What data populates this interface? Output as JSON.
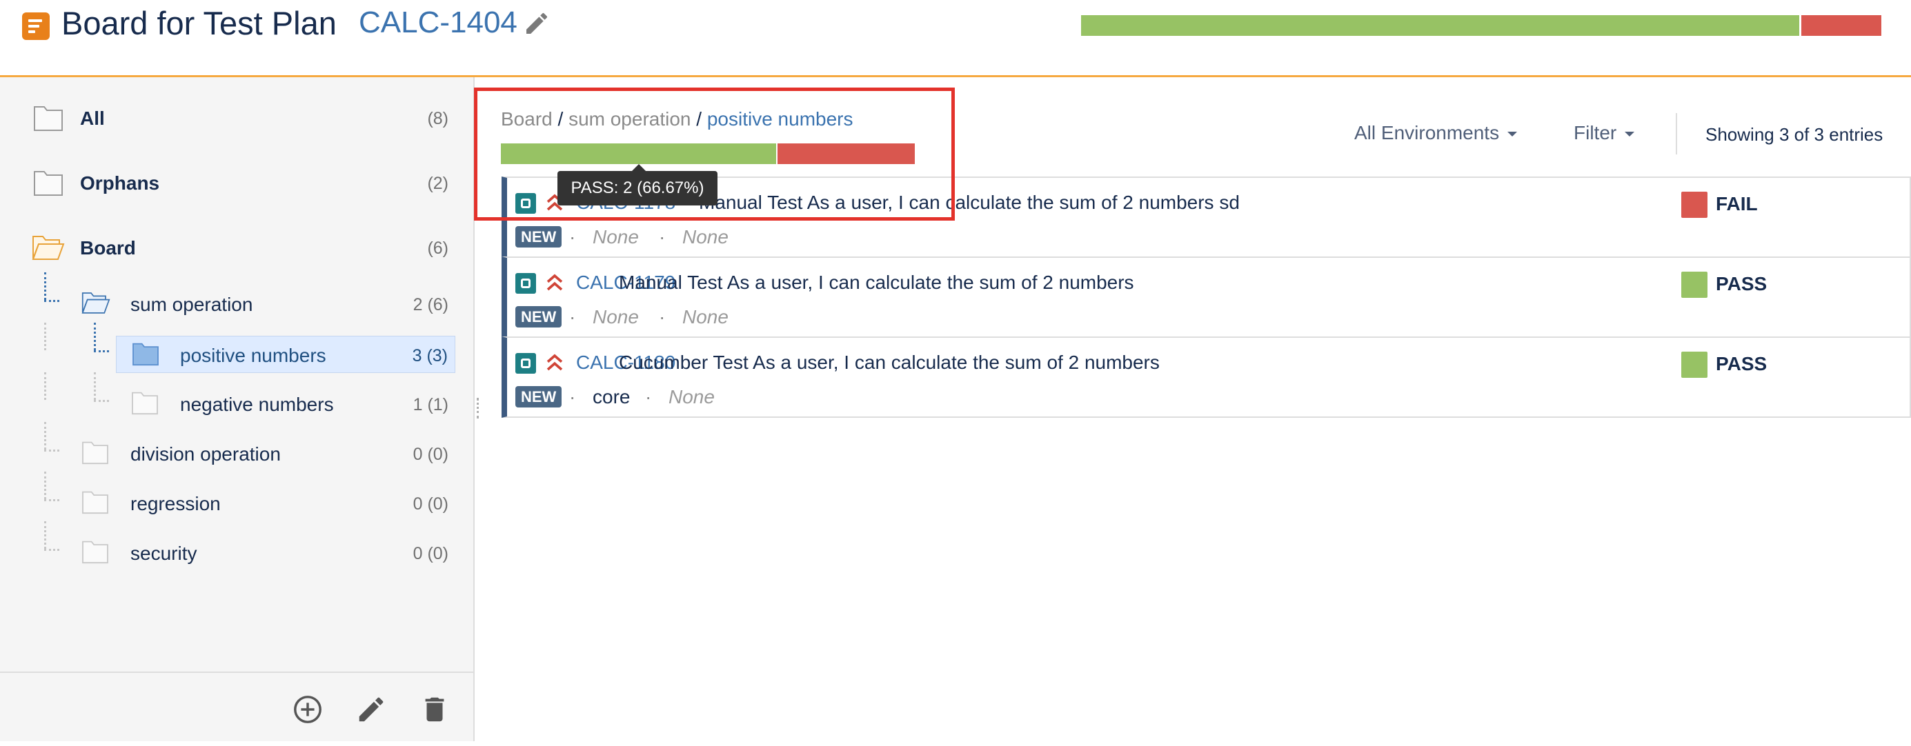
{
  "header": {
    "title": "Board for Test Plan",
    "issue_key": "CALC-1404",
    "progress": {
      "pass_fraction": 0.9,
      "fail_fraction": 0.1
    }
  },
  "sidebar": {
    "tree": [
      {
        "label": "All",
        "count": "(8)"
      },
      {
        "label": "Orphans",
        "count": "(2)"
      },
      {
        "label": "Board",
        "count": "(6)"
      },
      {
        "label": "sum operation",
        "count": "2 (6)"
      },
      {
        "label": "positive numbers",
        "count": "3 (3)"
      },
      {
        "label": "negative numbers",
        "count": "1 (1)"
      },
      {
        "label": "division operation",
        "count": "0 (0)"
      },
      {
        "label": "regression",
        "count": "0 (0)"
      },
      {
        "label": "security",
        "count": "0 (0)"
      }
    ]
  },
  "main": {
    "breadcrumb": [
      "Board",
      "sum operation",
      "positive numbers"
    ],
    "breadcrumb_separator": "/",
    "folder_progress": {
      "pass_fraction": 0.6667,
      "fail_fraction": 0.3333
    },
    "tooltip": "PASS: 2 (66.67%)",
    "environments_label": "All Environments",
    "filter_label": "Filter",
    "showing_text": "Showing 3 of 3 entries",
    "tests": [
      {
        "key": "CALC-1178",
        "summary": "Manual Test As a user, I can calculate the sum of 2 numbers sd",
        "badge": "NEW",
        "component": "None",
        "label": "None",
        "status": "FAIL"
      },
      {
        "key": "CALC-1179",
        "summary": "Manual Test As a user, I can calculate the sum of 2 numbers",
        "badge": "NEW",
        "component": "None",
        "label": "None",
        "status": "PASS"
      },
      {
        "key": "CALC-1180",
        "summary": "Cucumber Test As a user, I can calculate the sum of 2 numbers",
        "badge": "NEW",
        "component": "core",
        "label": "None",
        "status": "PASS"
      }
    ],
    "meta_separator": "·"
  },
  "colors": {
    "pass": "#97c264",
    "fail": "#d9574f",
    "accent": "#3b73af",
    "header_border": "#f6a940",
    "highlight": "#e3322b"
  },
  "icons": {
    "app": "test-plan-icon",
    "edit": "pencil-icon",
    "folder": "folder-icon",
    "folder_open": "folder-open-icon",
    "add": "add-circle-icon",
    "delete": "trash-icon",
    "test_type": "test-type-icon",
    "priority": "priority-highest-icon"
  }
}
